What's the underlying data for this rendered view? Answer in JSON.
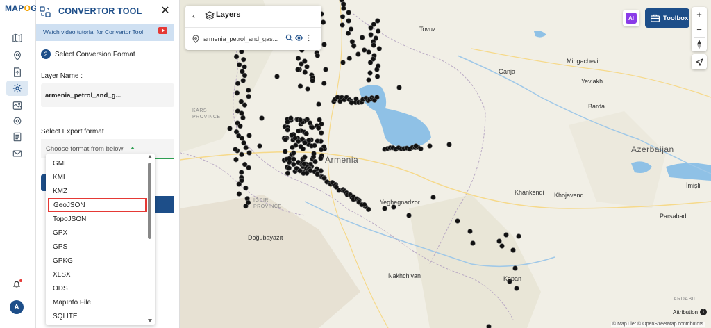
{
  "app": {
    "logo_text": "MAPOG",
    "panel_title": "CONVERTOR TOOL",
    "tutorial_link": "Watch video tutorial for Convertor Tool",
    "user_initial": "A"
  },
  "sidebar": {
    "items": [
      {
        "icon": "map-icon"
      },
      {
        "icon": "location-pin-icon"
      },
      {
        "icon": "upload-file-icon"
      },
      {
        "icon": "gear-icon",
        "active": true
      },
      {
        "icon": "map-layers-icon"
      },
      {
        "icon": "settings-icon"
      },
      {
        "icon": "document-icon"
      },
      {
        "icon": "email-icon"
      }
    ]
  },
  "converter": {
    "step_number": "2",
    "step_label": "Select Conversion Format",
    "layer_name_label": "Layer Name :",
    "layer_name_value": "armenia_petrol_and_g...",
    "export_format_label": "Select Export format",
    "format_placeholder": "Choose format from below",
    "formats": [
      "GML",
      "KML",
      "KMZ",
      "GeoJSON",
      "TopoJSON",
      "GPX",
      "GPS",
      "GPKG",
      "XLSX",
      "ODS",
      "MapInfo File",
      "SQLITE"
    ],
    "selected_format": "GeoJSON"
  },
  "layers_panel": {
    "title": "Layers",
    "layer_name": "armenia_petrol_and_gas..."
  },
  "toolbar": {
    "ai_label": "AI",
    "toolbox_label": "Toolbox",
    "zoom_in": "+",
    "zoom_out": "−"
  },
  "map": {
    "labels": {
      "toyuz": "Tovuz",
      "ganja": "Ganja",
      "mingachevir": "Mingachevir",
      "yevlakh": "Yevlakh",
      "barda": "Barda",
      "azerbaijan": "Azerbaijan",
      "armenia": "Armenia",
      "kars_province": "KARS\nPROVINCE",
      "igdir_province": "IĞDIR\nPROVINCE",
      "yeghegnadzor": "Yeghegnadzor",
      "khankendi": "Khankendi",
      "khojavend": "Khojavend",
      "imishli": "İmişli",
      "nakhchivan": "Nakhchivan",
      "dogubayazit": "Doğubayazıt",
      "parsabad": "Parsabad",
      "kapan": "Kapan",
      "ardabil": "ARDABIL"
    },
    "attribution": "Attribution",
    "copyright": "© MapTiler © OpenStreetMap contributors"
  },
  "colors": {
    "brand": "#1d4e89",
    "accent_gold": "#f2a100",
    "selected_outline": "#e53935",
    "water": "#8fc1e6",
    "land": "#f1efe6",
    "point": "#111111"
  }
}
